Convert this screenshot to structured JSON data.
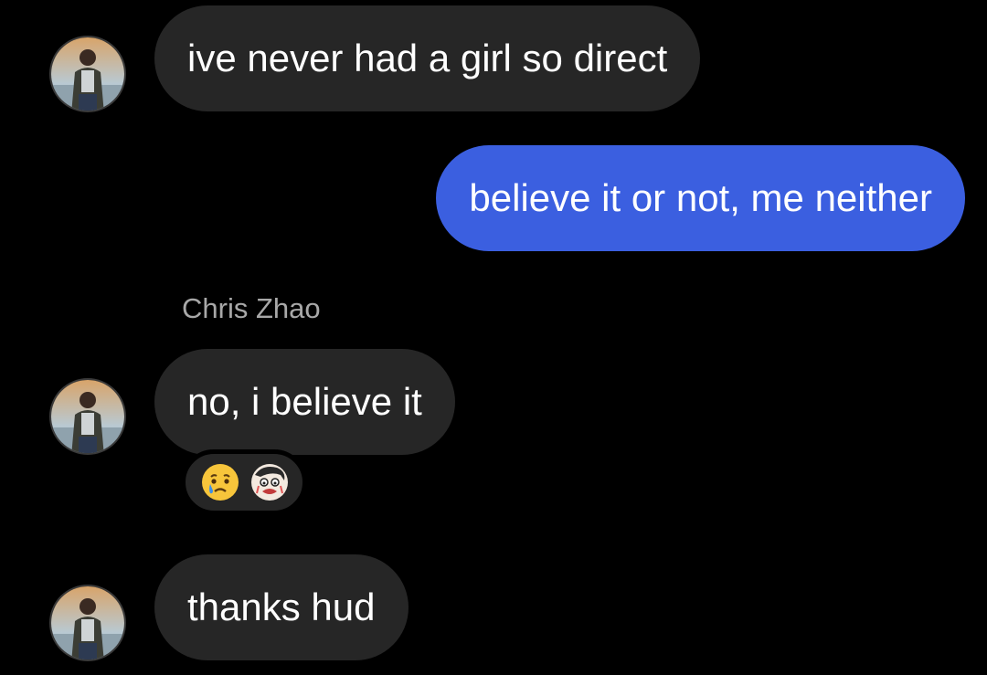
{
  "thread": {
    "messages": [
      {
        "sender": "other",
        "text": "ive never had a girl so direct"
      },
      {
        "sender": "me",
        "text": "believe it or not, me neither"
      },
      {
        "sender": "other",
        "sender_name": "Chris Zhao",
        "text": "no, i believe it",
        "reactions": [
          "crying-face-emoji",
          "crying-sticker-emoji"
        ]
      },
      {
        "sender": "other",
        "text": "thanks hud"
      }
    ]
  },
  "colors": {
    "background": "#000000",
    "incoming_bubble": "#262626",
    "outgoing_bubble": "#3b5fe0",
    "sender_name": "#a8a8a8",
    "text": "#ffffff"
  }
}
